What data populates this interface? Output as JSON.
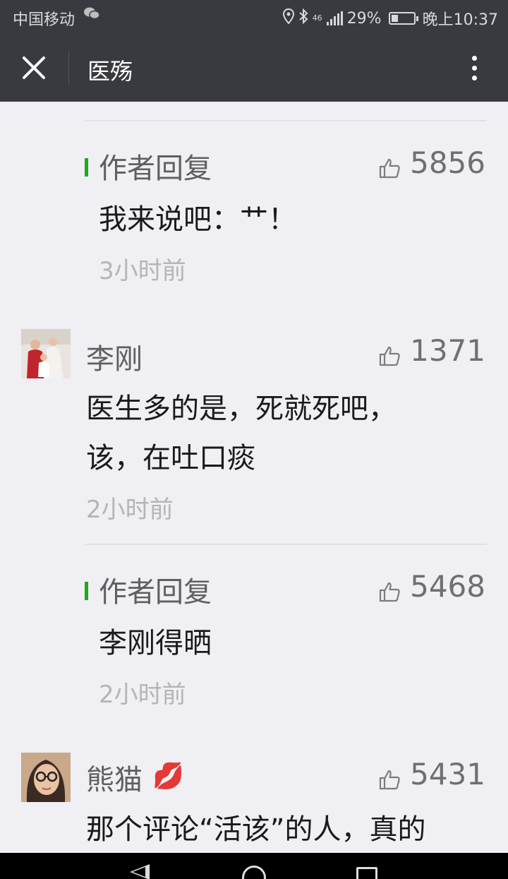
{
  "status_bar": {
    "carrier": "中国移动",
    "network": "46",
    "battery_text": "29%",
    "battery_level": 0.29,
    "time": "晚上10:37"
  },
  "header": {
    "title": "医殇"
  },
  "comments": [
    {
      "type": "author_reply",
      "label": "作者回复",
      "likes": "5856",
      "text": "我来说吧：艹！",
      "time": "3小时前"
    },
    {
      "type": "comment",
      "name": "李刚",
      "likes": "1371",
      "text_line1": "医生多的是，死就死吧，",
      "text_line2": "该，在吐口痰",
      "time": "2小时前"
    },
    {
      "type": "author_reply",
      "label": "作者回复",
      "likes": "5468",
      "text": "李刚得晒",
      "time": "2小时前"
    },
    {
      "type": "comment",
      "name": "熊猫",
      "name_emoji": "💋",
      "likes": "5431",
      "text_line1": "那个评论“活该”的人，真的"
    }
  ],
  "colors": {
    "header_bg": "#393a3f",
    "page_bg": "#efeff4",
    "reply_accent": "#1aad19",
    "muted_text": "#5f5f5f",
    "time_text": "#b5b5b5"
  }
}
